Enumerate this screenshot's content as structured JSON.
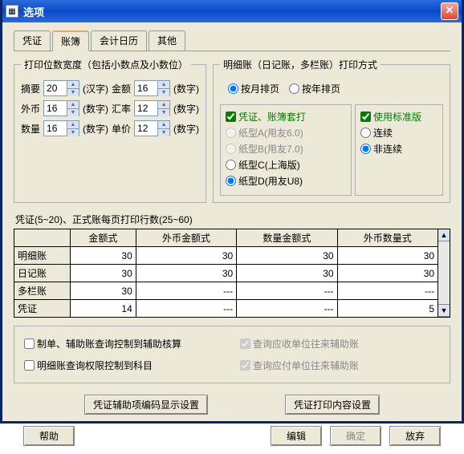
{
  "window": {
    "title": "选项"
  },
  "tabs": [
    "凭证",
    "账簿",
    "会计日历",
    "其他"
  ],
  "active_tab": 1,
  "printGroup": {
    "legend": "打印位数宽度（包括小数点及小数位）",
    "rows": [
      {
        "l1": "摘要",
        "v1": "20",
        "u1": "(汉字)",
        "l2": "金额",
        "v2": "16",
        "u2": "(数字)"
      },
      {
        "l1": "外币",
        "v1": "16",
        "u1": "(数字)",
        "l2": "汇率",
        "v2": "12",
        "u2": "(数字)"
      },
      {
        "l1": "数量",
        "v1": "16",
        "u1": "(数字)",
        "l2": "单价",
        "v2": "12",
        "u2": "(数字)"
      }
    ]
  },
  "detailGroup": {
    "legend": "明细账（日记账，多栏账）打印方式",
    "r1": "按月排页",
    "r2": "按年排页",
    "chk1": "凭证、账簿套打",
    "opt_a": "纸型A(用友6.0)",
    "opt_b": "纸型B(用友7.0)",
    "opt_c": "纸型C(上海版)",
    "opt_d": "纸型D(用友U8)",
    "chk_std": "使用标准版",
    "r_cont": "连续",
    "r_noncont": "非连续"
  },
  "tableTitle": "凭证(5~20)、正式账每页打印行数(25~60)",
  "tableHeaders": [
    "",
    "金额式",
    "外币金额式",
    "数量金额式",
    "外币数量式"
  ],
  "tableRows": [
    {
      "h": "明细账",
      "c": [
        "30",
        "30",
        "30",
        "30"
      ]
    },
    {
      "h": "日记账",
      "c": [
        "30",
        "30",
        "30",
        "30"
      ]
    },
    {
      "h": "多栏账",
      "c": [
        "30",
        "---",
        "---",
        "---"
      ]
    },
    {
      "h": "凭证",
      "c": [
        "14",
        "---",
        "---",
        "5"
      ]
    }
  ],
  "lowerChecks": {
    "c1": "制单、辅助账查询控制到辅助核算",
    "c2": "查询应收单位往来辅助账",
    "c3": "明细账查询权限控制到科目",
    "c4": "查询应付单位往来辅助账"
  },
  "midButtons": {
    "b1": "凭证辅助项编码显示设置",
    "b2": "凭证打印内容设置"
  },
  "bottomButtons": {
    "help": "帮助",
    "edit": "编辑",
    "ok": "确定",
    "cancel": "放弃"
  }
}
